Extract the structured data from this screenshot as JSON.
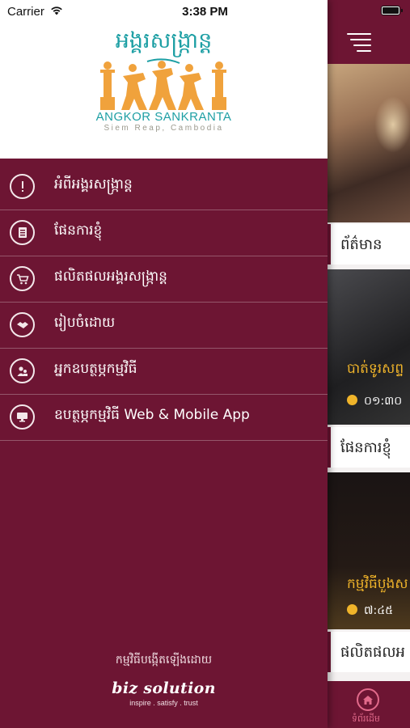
{
  "status_bar": {
    "carrier": "Carrier",
    "time": "3:38 PM"
  },
  "drawer": {
    "logo": {
      "khmer_title": "អង្គរសង្ក្រាន្ត",
      "title": "ANGKOR SANKRANTA",
      "subtitle": "Siem Reap, Cambodia"
    },
    "menu": [
      {
        "label": "អំពីអង្គរសង្ក្រាន្ត",
        "icon": "info-icon"
      },
      {
        "label": "ផែនការខ្ញុំ",
        "icon": "document-list-icon"
      },
      {
        "label": "ផលិតផលអង្គរសង្ក្រាន្ត",
        "icon": "cart-icon"
      },
      {
        "label": "រៀបចំដោយ",
        "icon": "handshake-icon"
      },
      {
        "label": "អ្នកឧបត្ថម្ភកម្មវិធី",
        "icon": "sponsor-people-icon"
      },
      {
        "label": "ឧបត្ថម្ភកម្មវិធី Web & Mobile App",
        "icon": "monitor-icon"
      }
    ],
    "credit_label": "កម្មវិធីបង្កើតឡើងដោយ",
    "credit_logo": "biz solution",
    "credit_tagline": "inspire . satisfy . trust"
  },
  "main": {
    "section_news": "ព័ត៌មាន",
    "card1": {
      "title": "បាត់ទូរសព្ទ",
      "time": "០១:៣០"
    },
    "section_plan": "ផែនការខ្ញុំ",
    "card2": {
      "title": "កម្មវិធីបួងស",
      "time": "៧:៤៥"
    },
    "section_products": "ផលិតផលអ",
    "tab_home_label": "ទំព័រដើម"
  },
  "colors": {
    "brand": "#6d1533",
    "logo_teal": "#1d9fa4",
    "accent_gold": "#f0b42a"
  }
}
